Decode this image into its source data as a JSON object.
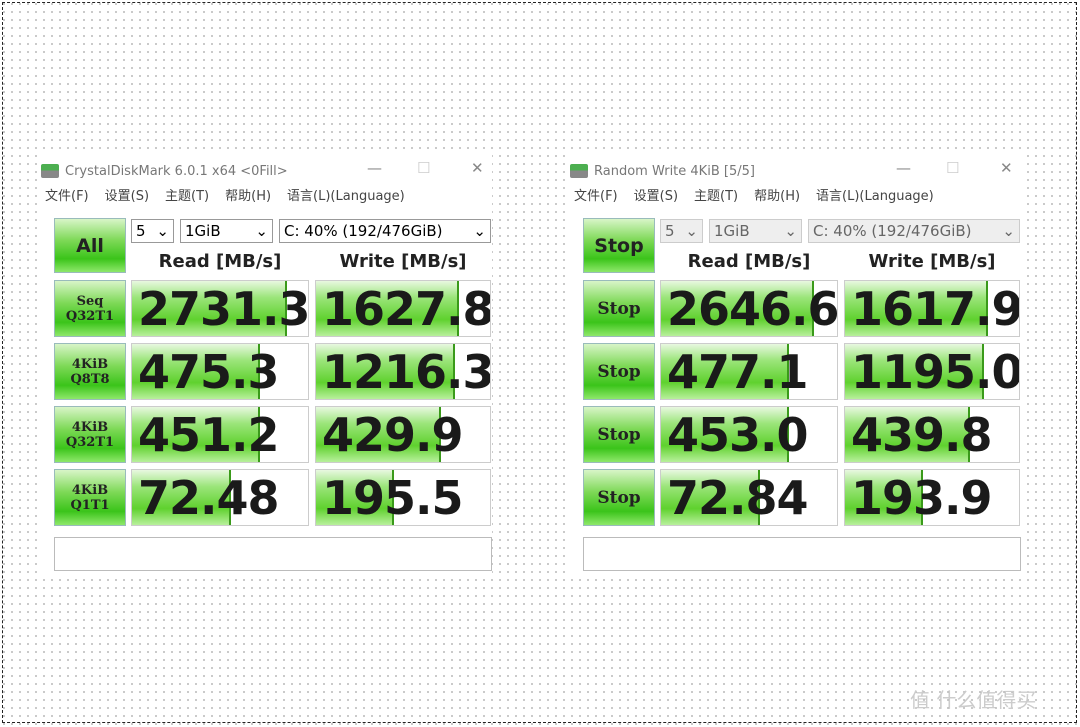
{
  "windows": [
    {
      "title": "CrystalDiskMark 6.0.1 x64 <0Fill>",
      "menu": [
        "文件(F)",
        "设置(S)",
        "主题(T)",
        "帮助(H)",
        "语言(L)(Language)"
      ],
      "main_button": "All",
      "count": "5",
      "size": "1GiB",
      "drive": "C: 40% (192/476GiB)",
      "read_header": "Read [MB/s]",
      "write_header": "Write [MB/s]",
      "rows": [
        {
          "label1": "Seq",
          "label2": "Q32T1",
          "read": "2731.3",
          "write": "1627.8",
          "read_fill": 0.88,
          "write_fill": 0.82
        },
        {
          "label1": "4KiB",
          "label2": "Q8T8",
          "read": "475.3",
          "write": "1216.3",
          "read_fill": 0.73,
          "write_fill": 0.8
        },
        {
          "label1": "4KiB",
          "label2": "Q32T1",
          "read": "451.2",
          "write": "429.9",
          "read_fill": 0.73,
          "write_fill": 0.72
        },
        {
          "label1": "4KiB",
          "label2": "Q1T1",
          "read": "72.48",
          "write": "195.5",
          "read_fill": 0.56,
          "write_fill": 0.45
        }
      ],
      "status": ""
    },
    {
      "title": "Random Write 4KiB [5/5]",
      "menu": [
        "文件(F)",
        "设置(S)",
        "主题(T)",
        "帮助(H)",
        "语言(L)(Language)"
      ],
      "main_button": "Stop",
      "count": "5",
      "size": "1GiB",
      "drive": "C: 40% (192/476GiB)",
      "read_header": "Read [MB/s]",
      "write_header": "Write [MB/s]",
      "rows": [
        {
          "label1": "Stop",
          "label2": "",
          "read": "2646.6",
          "write": "1617.9",
          "read_fill": 0.87,
          "write_fill": 0.82
        },
        {
          "label1": "Stop",
          "label2": "",
          "read": "477.1",
          "write": "1195.0",
          "read_fill": 0.73,
          "write_fill": 0.8
        },
        {
          "label1": "Stop",
          "label2": "",
          "read": "453.0",
          "write": "439.8",
          "read_fill": 0.73,
          "write_fill": 0.72
        },
        {
          "label1": "Stop",
          "label2": "",
          "read": "72.84",
          "write": "193.9",
          "read_fill": 0.56,
          "write_fill": 0.45
        }
      ],
      "status": ""
    }
  ],
  "watermark": "值 什么值得买",
  "colors": {
    "accent_green": "#5fd12e"
  }
}
